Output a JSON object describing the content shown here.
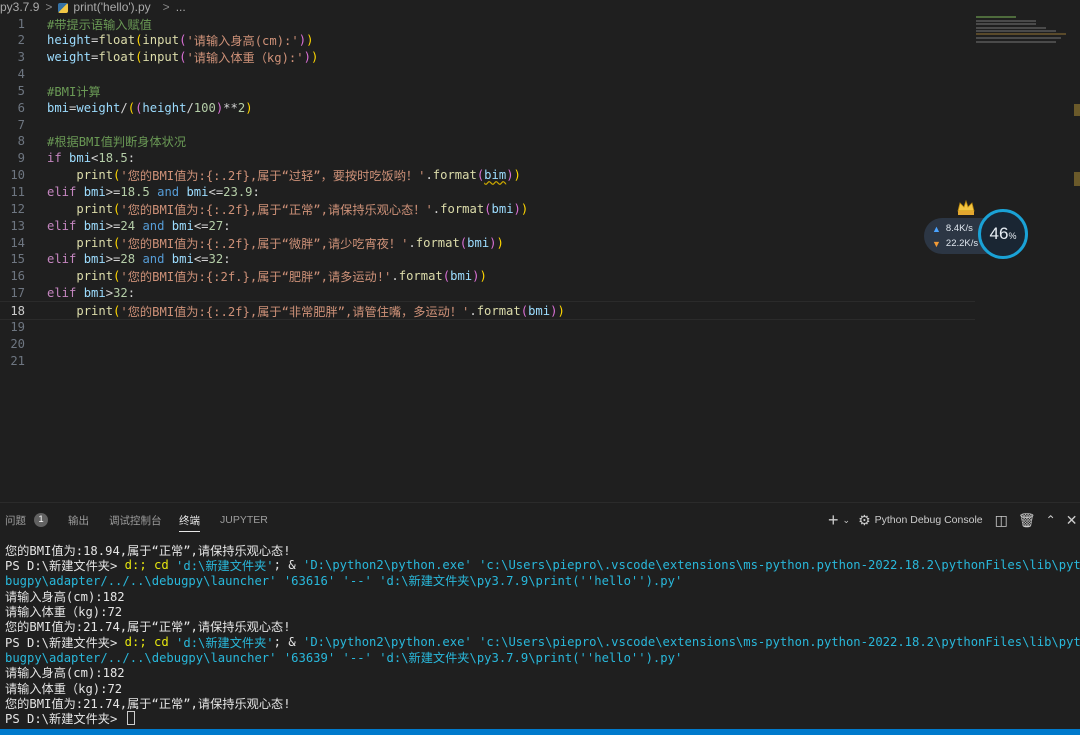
{
  "breadcrumb": {
    "folder": "py3.7.9",
    "separator": ">",
    "file": "print('hello').py",
    "separator2": ">",
    "more": "..."
  },
  "editor": {
    "lines": [
      {
        "num": "1",
        "tokens": [
          {
            "t": "#带提示语输入赋值",
            "c": "c"
          }
        ]
      },
      {
        "num": "2",
        "tokens": [
          {
            "t": "height",
            "c": "v"
          },
          {
            "t": "=",
            "c": "p"
          },
          {
            "t": "float",
            "c": "f"
          },
          {
            "t": "(",
            "c": "br1"
          },
          {
            "t": "input",
            "c": "f"
          },
          {
            "t": "(",
            "c": "br2"
          },
          {
            "t": "'请输入身高(cm):'",
            "c": "s"
          },
          {
            "t": ")",
            "c": "br2"
          },
          {
            "t": ")",
            "c": "br1"
          }
        ]
      },
      {
        "num": "3",
        "tokens": [
          {
            "t": "weight",
            "c": "v"
          },
          {
            "t": "=",
            "c": "p"
          },
          {
            "t": "float",
            "c": "f"
          },
          {
            "t": "(",
            "c": "br1"
          },
          {
            "t": "input",
            "c": "f"
          },
          {
            "t": "(",
            "c": "br2"
          },
          {
            "t": "'请输入体重（kg):'",
            "c": "s"
          },
          {
            "t": ")",
            "c": "br2"
          },
          {
            "t": ")",
            "c": "br1"
          }
        ]
      },
      {
        "num": "4",
        "tokens": []
      },
      {
        "num": "5",
        "tokens": [
          {
            "t": "#BMI计算",
            "c": "c"
          }
        ]
      },
      {
        "num": "6",
        "tokens": [
          {
            "t": "bmi",
            "c": "v"
          },
          {
            "t": "=",
            "c": "p"
          },
          {
            "t": "weight",
            "c": "v"
          },
          {
            "t": "/",
            "c": "p"
          },
          {
            "t": "(",
            "c": "br1"
          },
          {
            "t": "(",
            "c": "br2"
          },
          {
            "t": "height",
            "c": "v"
          },
          {
            "t": "/",
            "c": "p"
          },
          {
            "t": "100",
            "c": "n"
          },
          {
            "t": ")",
            "c": "br2"
          },
          {
            "t": "**",
            "c": "p"
          },
          {
            "t": "2",
            "c": "n"
          },
          {
            "t": ")",
            "c": "br1"
          }
        ]
      },
      {
        "num": "7",
        "tokens": []
      },
      {
        "num": "8",
        "tokens": [
          {
            "t": "#根据BMI值判断身体状况",
            "c": "c"
          }
        ]
      },
      {
        "num": "9",
        "tokens": [
          {
            "t": "if",
            "c": "k"
          },
          {
            "t": " ",
            "c": "p"
          },
          {
            "t": "bmi",
            "c": "v"
          },
          {
            "t": "<",
            "c": "p"
          },
          {
            "t": "18.5",
            "c": "n"
          },
          {
            "t": ":",
            "c": "p"
          }
        ]
      },
      {
        "num": "10",
        "tokens": [
          {
            "t": "    ",
            "c": "p"
          },
          {
            "t": "print",
            "c": "f"
          },
          {
            "t": "(",
            "c": "br1"
          },
          {
            "t": "'您的BMI值为:{:.2f},属于“过轻”，要按时吃饭哟！'",
            "c": "s"
          },
          {
            "t": ".",
            "c": "p"
          },
          {
            "t": "format",
            "c": "f"
          },
          {
            "t": "(",
            "c": "br2"
          },
          {
            "t": "bim",
            "c": "v",
            "squig": true
          },
          {
            "t": ")",
            "c": "br2"
          },
          {
            "t": ")",
            "c": "br1"
          }
        ]
      },
      {
        "num": "11",
        "tokens": [
          {
            "t": "elif",
            "c": "k"
          },
          {
            "t": " ",
            "c": "p"
          },
          {
            "t": "bmi",
            "c": "v"
          },
          {
            "t": ">=",
            "c": "p"
          },
          {
            "t": "18.5",
            "c": "n"
          },
          {
            "t": " ",
            "c": "p"
          },
          {
            "t": "and",
            "c": "kw"
          },
          {
            "t": " ",
            "c": "p"
          },
          {
            "t": "bmi",
            "c": "v"
          },
          {
            "t": "<=",
            "c": "p"
          },
          {
            "t": "23.9",
            "c": "n"
          },
          {
            "t": ":",
            "c": "p"
          }
        ]
      },
      {
        "num": "12",
        "tokens": [
          {
            "t": "    ",
            "c": "p"
          },
          {
            "t": "print",
            "c": "f"
          },
          {
            "t": "(",
            "c": "br1"
          },
          {
            "t": "'您的BMI值为:{:.2f},属于“正常”,请保持乐观心态！'",
            "c": "s"
          },
          {
            "t": ".",
            "c": "p"
          },
          {
            "t": "format",
            "c": "f"
          },
          {
            "t": "(",
            "c": "br2"
          },
          {
            "t": "bmi",
            "c": "v"
          },
          {
            "t": ")",
            "c": "br2"
          },
          {
            "t": ")",
            "c": "br1"
          }
        ]
      },
      {
        "num": "13",
        "tokens": [
          {
            "t": "elif",
            "c": "k"
          },
          {
            "t": " ",
            "c": "p"
          },
          {
            "t": "bmi",
            "c": "v"
          },
          {
            "t": ">=",
            "c": "p"
          },
          {
            "t": "24",
            "c": "n"
          },
          {
            "t": " ",
            "c": "p"
          },
          {
            "t": "and",
            "c": "kw"
          },
          {
            "t": " ",
            "c": "p"
          },
          {
            "t": "bmi",
            "c": "v"
          },
          {
            "t": "<=",
            "c": "p"
          },
          {
            "t": "27",
            "c": "n"
          },
          {
            "t": ":",
            "c": "p"
          }
        ]
      },
      {
        "num": "14",
        "tokens": [
          {
            "t": "    ",
            "c": "p"
          },
          {
            "t": "print",
            "c": "f"
          },
          {
            "t": "(",
            "c": "br1"
          },
          {
            "t": "'您的BMI值为:{:.2f},属于“微胖”,请少吃宵夜！'",
            "c": "s"
          },
          {
            "t": ".",
            "c": "p"
          },
          {
            "t": "format",
            "c": "f"
          },
          {
            "t": "(",
            "c": "br2"
          },
          {
            "t": "bmi",
            "c": "v"
          },
          {
            "t": ")",
            "c": "br2"
          },
          {
            "t": ")",
            "c": "br1"
          }
        ]
      },
      {
        "num": "15",
        "tokens": [
          {
            "t": "elif",
            "c": "k"
          },
          {
            "t": " ",
            "c": "p"
          },
          {
            "t": "bmi",
            "c": "v"
          },
          {
            "t": ">=",
            "c": "p"
          },
          {
            "t": "28",
            "c": "n"
          },
          {
            "t": " ",
            "c": "p"
          },
          {
            "t": "and",
            "c": "kw"
          },
          {
            "t": " ",
            "c": "p"
          },
          {
            "t": "bmi",
            "c": "v"
          },
          {
            "t": "<=",
            "c": "p"
          },
          {
            "t": "32",
            "c": "n"
          },
          {
            "t": ":",
            "c": "p"
          }
        ]
      },
      {
        "num": "16",
        "tokens": [
          {
            "t": "    ",
            "c": "p"
          },
          {
            "t": "print",
            "c": "f"
          },
          {
            "t": "(",
            "c": "br1"
          },
          {
            "t": "'您的BMI值为:{:2f.},属于“肥胖”,请多运动!'",
            "c": "s"
          },
          {
            "t": ".",
            "c": "p"
          },
          {
            "t": "format",
            "c": "f"
          },
          {
            "t": "(",
            "c": "br2"
          },
          {
            "t": "bmi",
            "c": "v"
          },
          {
            "t": ")",
            "c": "br2"
          },
          {
            "t": ")",
            "c": "br1"
          }
        ]
      },
      {
        "num": "17",
        "tokens": [
          {
            "t": "elif",
            "c": "k"
          },
          {
            "t": " ",
            "c": "p"
          },
          {
            "t": "bmi",
            "c": "v"
          },
          {
            "t": ">",
            "c": "p"
          },
          {
            "t": "32",
            "c": "n"
          },
          {
            "t": ":",
            "c": "p"
          }
        ]
      },
      {
        "num": "18",
        "current": true,
        "tokens": [
          {
            "t": "    ",
            "c": "p"
          },
          {
            "t": "print",
            "c": "f"
          },
          {
            "t": "(",
            "c": "br1"
          },
          {
            "t": "'您的BMI值为:{:.2f},属于“非常肥胖”,请管住嘴，多运动！'",
            "c": "s"
          },
          {
            "t": ".",
            "c": "p"
          },
          {
            "t": "format",
            "c": "f"
          },
          {
            "t": "(",
            "c": "br2"
          },
          {
            "t": "bmi",
            "c": "v"
          },
          {
            "t": ")",
            "c": "br2"
          },
          {
            "t": ")",
            "c": "br1"
          }
        ]
      },
      {
        "num": "19",
        "tokens": []
      },
      {
        "num": "20",
        "tokens": []
      },
      {
        "num": "21",
        "tokens": []
      }
    ]
  },
  "net_monitor": {
    "upload": "8.4",
    "download": "22.2",
    "unit": "K/s",
    "percent": "46",
    "percent_unit": "%"
  },
  "panel": {
    "tabs": [
      {
        "label": "问题",
        "badge": "1"
      },
      {
        "label": "输出"
      },
      {
        "label": "调试控制台"
      },
      {
        "label": "终端",
        "active": true
      },
      {
        "label": "JUPYTER"
      }
    ],
    "add_icon": "plus-icon",
    "chevron_icon": "chevron-down-icon",
    "debug_console_label": "Python Debug Console",
    "debug_icon": "gear-bug-icon"
  },
  "terminal": {
    "lines": [
      [
        {
          "t": "您的BMI值为:18.94,属于“正常”,请保持乐观心态!",
          "c": "tw"
        }
      ],
      [
        {
          "t": "PS D:\\新建文件夹> ",
          "c": "tw"
        },
        {
          "t": "d:; cd",
          "c": "ty"
        },
        {
          "t": " ",
          "c": "tw"
        },
        {
          "t": "'d:\\新建文件夹'",
          "c": "tc"
        },
        {
          "t": "; & ",
          "c": "tw"
        },
        {
          "t": "'D:\\python2\\python.exe' 'c:\\Users\\piepro\\.vscode\\extensions\\ms-python.python-2022.18.2\\pythonFiles\\lib\\python\\de",
          "c": "tc"
        }
      ],
      [
        {
          "t": "bugpy\\adapter/../..\\debugpy\\launcher' '63616' '--' 'd:\\新建文件夹\\py3.7.9\\print(''hello'').py'",
          "c": "tc"
        }
      ],
      [
        {
          "t": "请输入身高(cm):182",
          "c": "tw"
        }
      ],
      [
        {
          "t": "请输入体重（kg):72",
          "c": "tw"
        }
      ],
      [
        {
          "t": "您的BMI值为:21.74,属于“正常”,请保持乐观心态!",
          "c": "tw"
        }
      ],
      [
        {
          "t": "PS D:\\新建文件夹> ",
          "c": "tw"
        },
        {
          "t": "d:; cd",
          "c": "ty"
        },
        {
          "t": " ",
          "c": "tw"
        },
        {
          "t": "'d:\\新建文件夹'",
          "c": "tc"
        },
        {
          "t": "; & ",
          "c": "tw"
        },
        {
          "t": "'D:\\python2\\python.exe' 'c:\\Users\\piepro\\.vscode\\extensions\\ms-python.python-2022.18.2\\pythonFiles\\lib\\python\\de",
          "c": "tc"
        }
      ],
      [
        {
          "t": "bugpy\\adapter/../..\\debugpy\\launcher' '63639' '--' 'd:\\新建文件夹\\py3.7.9\\print(''hello'').py'",
          "c": "tc"
        }
      ],
      [
        {
          "t": "请输入身高(cm):182",
          "c": "tw"
        }
      ],
      [
        {
          "t": "请输入体重（kg):72",
          "c": "tw"
        }
      ],
      [
        {
          "t": "您的BMI值为:21.74,属于“正常”,请保持乐观心态!",
          "c": "tw"
        }
      ],
      [
        {
          "t": "PS D:\\新建文件夹> ",
          "c": "tw"
        }
      ]
    ]
  }
}
